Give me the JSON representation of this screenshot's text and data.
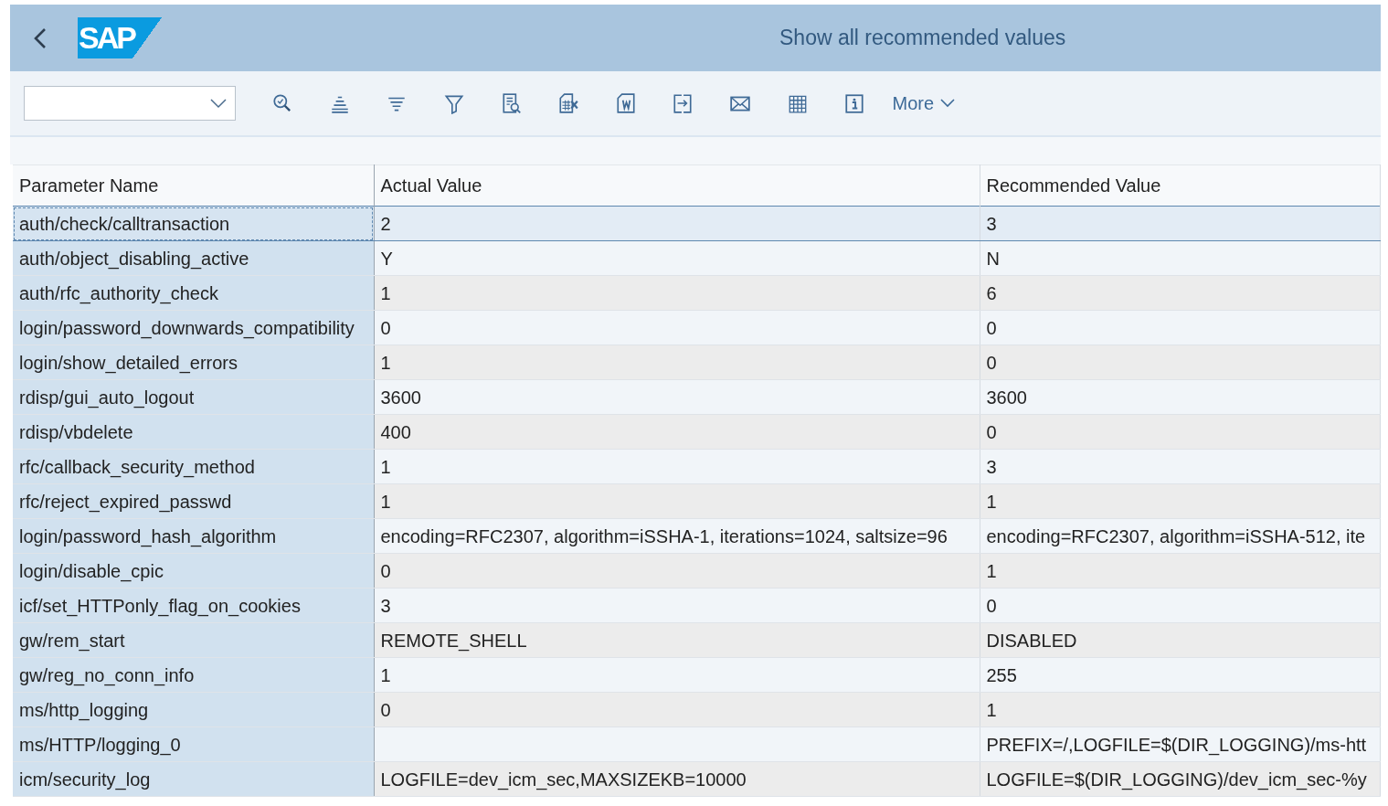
{
  "header": {
    "logo": "SAP",
    "title": "Show all recommended values"
  },
  "toolbar": {
    "more": "More"
  },
  "table": {
    "columns": [
      "Parameter Name",
      "Actual Value",
      "Recommended Value"
    ],
    "rows": [
      {
        "selected": true,
        "cells": [
          "auth/check/calltransaction",
          "2",
          "3"
        ]
      },
      {
        "selected": false,
        "cells": [
          "auth/object_disabling_active",
          "Y",
          "N"
        ]
      },
      {
        "selected": false,
        "cells": [
          "auth/rfc_authority_check",
          "1",
          "6"
        ]
      },
      {
        "selected": false,
        "cells": [
          "login/password_downwards_compatibility",
          "0",
          "0"
        ]
      },
      {
        "selected": false,
        "cells": [
          "login/show_detailed_errors",
          "1",
          "0"
        ]
      },
      {
        "selected": false,
        "cells": [
          "rdisp/gui_auto_logout",
          "3600",
          "3600"
        ]
      },
      {
        "selected": false,
        "cells": [
          "rdisp/vbdelete",
          "400",
          "0"
        ]
      },
      {
        "selected": false,
        "cells": [
          "rfc/callback_security_method",
          "1",
          "3"
        ]
      },
      {
        "selected": false,
        "cells": [
          "rfc/reject_expired_passwd",
          "1",
          "1"
        ]
      },
      {
        "selected": false,
        "cells": [
          "login/password_hash_algorithm",
          "encoding=RFC2307, algorithm=iSSHA-1, iterations=1024, saltsize=96",
          "encoding=RFC2307, algorithm=iSSHA-512, ite"
        ]
      },
      {
        "selected": false,
        "cells": [
          "login/disable_cpic",
          "0",
          "1"
        ]
      },
      {
        "selected": false,
        "cells": [
          "icf/set_HTTPonly_flag_on_cookies",
          "3",
          "0"
        ]
      },
      {
        "selected": false,
        "cells": [
          "gw/rem_start",
          "REMOTE_SHELL",
          "DISABLED"
        ]
      },
      {
        "selected": false,
        "cells": [
          "gw/reg_no_conn_info",
          "1",
          "255"
        ]
      },
      {
        "selected": false,
        "cells": [
          "ms/http_logging",
          "0",
          "1"
        ]
      },
      {
        "selected": false,
        "cells": [
          "ms/HTTP/logging_0",
          "",
          "PREFIX=/,LOGFILE=$(DIR_LOGGING)/ms-htt"
        ]
      },
      {
        "selected": false,
        "cells": [
          "icm/security_log",
          "LOGFILE=dev_icm_sec,MAXSIZEKB=10000",
          "LOGFILE=$(DIR_LOGGING)/dev_icm_sec-%y"
        ]
      }
    ]
  }
}
